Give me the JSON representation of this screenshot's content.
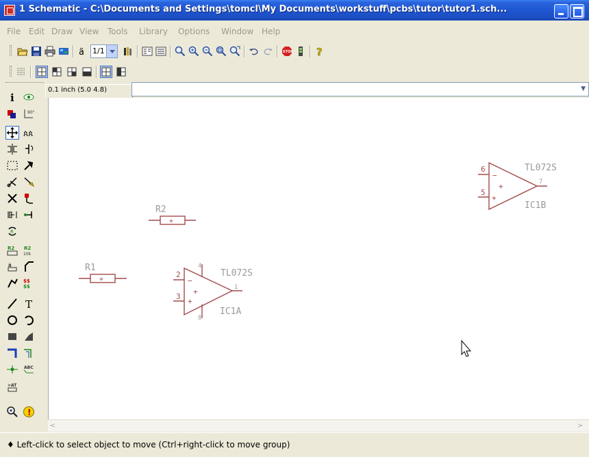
{
  "window": {
    "title": "1 Schematic - C:\\Documents and Settings\\tomcl\\My Documents\\workstuff\\pcbs\\tutor\\tutor1.sch..."
  },
  "menu": [
    "File",
    "Edit",
    "Draw",
    "View",
    "Tools",
    "Library",
    "Options",
    "Window",
    "Help"
  ],
  "toolbar": {
    "sheet_value": "1/1",
    "icons": [
      "open-icon",
      "save-icon",
      "print-icon",
      "netlist-icon",
      "ratio-icon",
      "library-icon",
      "drc-icon",
      "bom-icon",
      "zoom-in-icon",
      "zoom-out-icon",
      "zoom-area-icon",
      "zoom-fit-icon",
      "zoom-previous-icon",
      "undo-icon",
      "redo-icon",
      "stop-icon",
      "battery-icon",
      "help-icon"
    ],
    "layout_icons": [
      "grid-icon",
      "view-1-icon",
      "view-2-icon",
      "view-3-icon",
      "view-4-icon",
      "view-5-icon",
      "view-6-icon"
    ]
  },
  "tab": {
    "label": "0.1 inch (5.0 4.8)"
  },
  "command_input": {
    "value": ""
  },
  "palette": {
    "tools": [
      "info-icon",
      "eye-icon",
      "color-icon",
      "coords-icon",
      "move-icon",
      "move-group-icon",
      "mirror-icon",
      "rotate-icon",
      "select-area-icon",
      "repair-icon",
      "cut-icon",
      "highlight-icon",
      "delete-icon",
      "swap-icon",
      "align-icon",
      "connect-icon",
      "rotate-group-icon",
      "rename-icon",
      "value-icon",
      "smash-icon",
      "miter-icon",
      "split-icon",
      "attributes-icon",
      "line-icon",
      "text-icon",
      "circle-icon",
      "arc-icon",
      "rect-icon",
      "polygon-icon",
      "bus-icon",
      "net-icon",
      "junction-icon",
      "label-icon",
      "attribute-icon",
      "zoom-icon",
      "erc-icon"
    ]
  },
  "schematic": {
    "components": [
      {
        "ref": "R1",
        "type": "resistor",
        "symbol": "+"
      },
      {
        "ref": "R2",
        "type": "resistor",
        "symbol": "+"
      },
      {
        "ref": "IC1A",
        "value": "TL072S",
        "pins": [
          "2",
          "3",
          "1",
          "4",
          "8"
        ],
        "pin_minus": "−",
        "pin_plus": "+"
      },
      {
        "ref": "IC1B",
        "value": "TL072S",
        "pins": [
          "6",
          "5",
          "7"
        ],
        "pin_minus": "−",
        "pin_plus": "+"
      }
    ]
  },
  "status": {
    "message": "♦ Left-click to select object to move (Ctrl+right-click to move group)"
  },
  "colors": {
    "titlebar": "#1e55d0",
    "schematic_symbol": "#a24a4a",
    "schematic_text": "#9a9a9a",
    "chrome": "#ece9d8"
  }
}
